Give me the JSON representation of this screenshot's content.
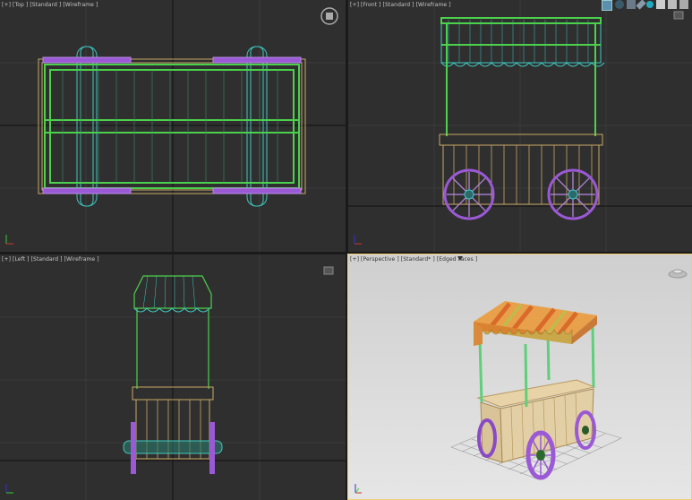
{
  "viewports": {
    "top": {
      "label": "[+] [Top ] [Standard ] [Wireframe ]"
    },
    "front": {
      "label": "[+] [Front ] [Standard ] [Wireframe ]"
    },
    "left": {
      "label": "[+] [Left ] [Standard ] [Wireframe ]"
    },
    "perspective": {
      "label": "[+] [Perspective ] [Standard* ] [Edged Faces ]"
    }
  },
  "toolbar_icons": [
    "select-icon",
    "rotate-icon",
    "scale-icon",
    "link-icon",
    "snap-icon",
    "render-icon",
    "camera-icon",
    "light-icon"
  ],
  "colors": {
    "viewport_bg": "#2f2f2f",
    "perspective_bg": "#d9d9d9",
    "wire_green": "#4cd14c",
    "wire_tan": "#c9a865",
    "wire_purple": "#9b59d6",
    "wire_cyan": "#3fc8c0",
    "active_border": "#f0d070"
  }
}
